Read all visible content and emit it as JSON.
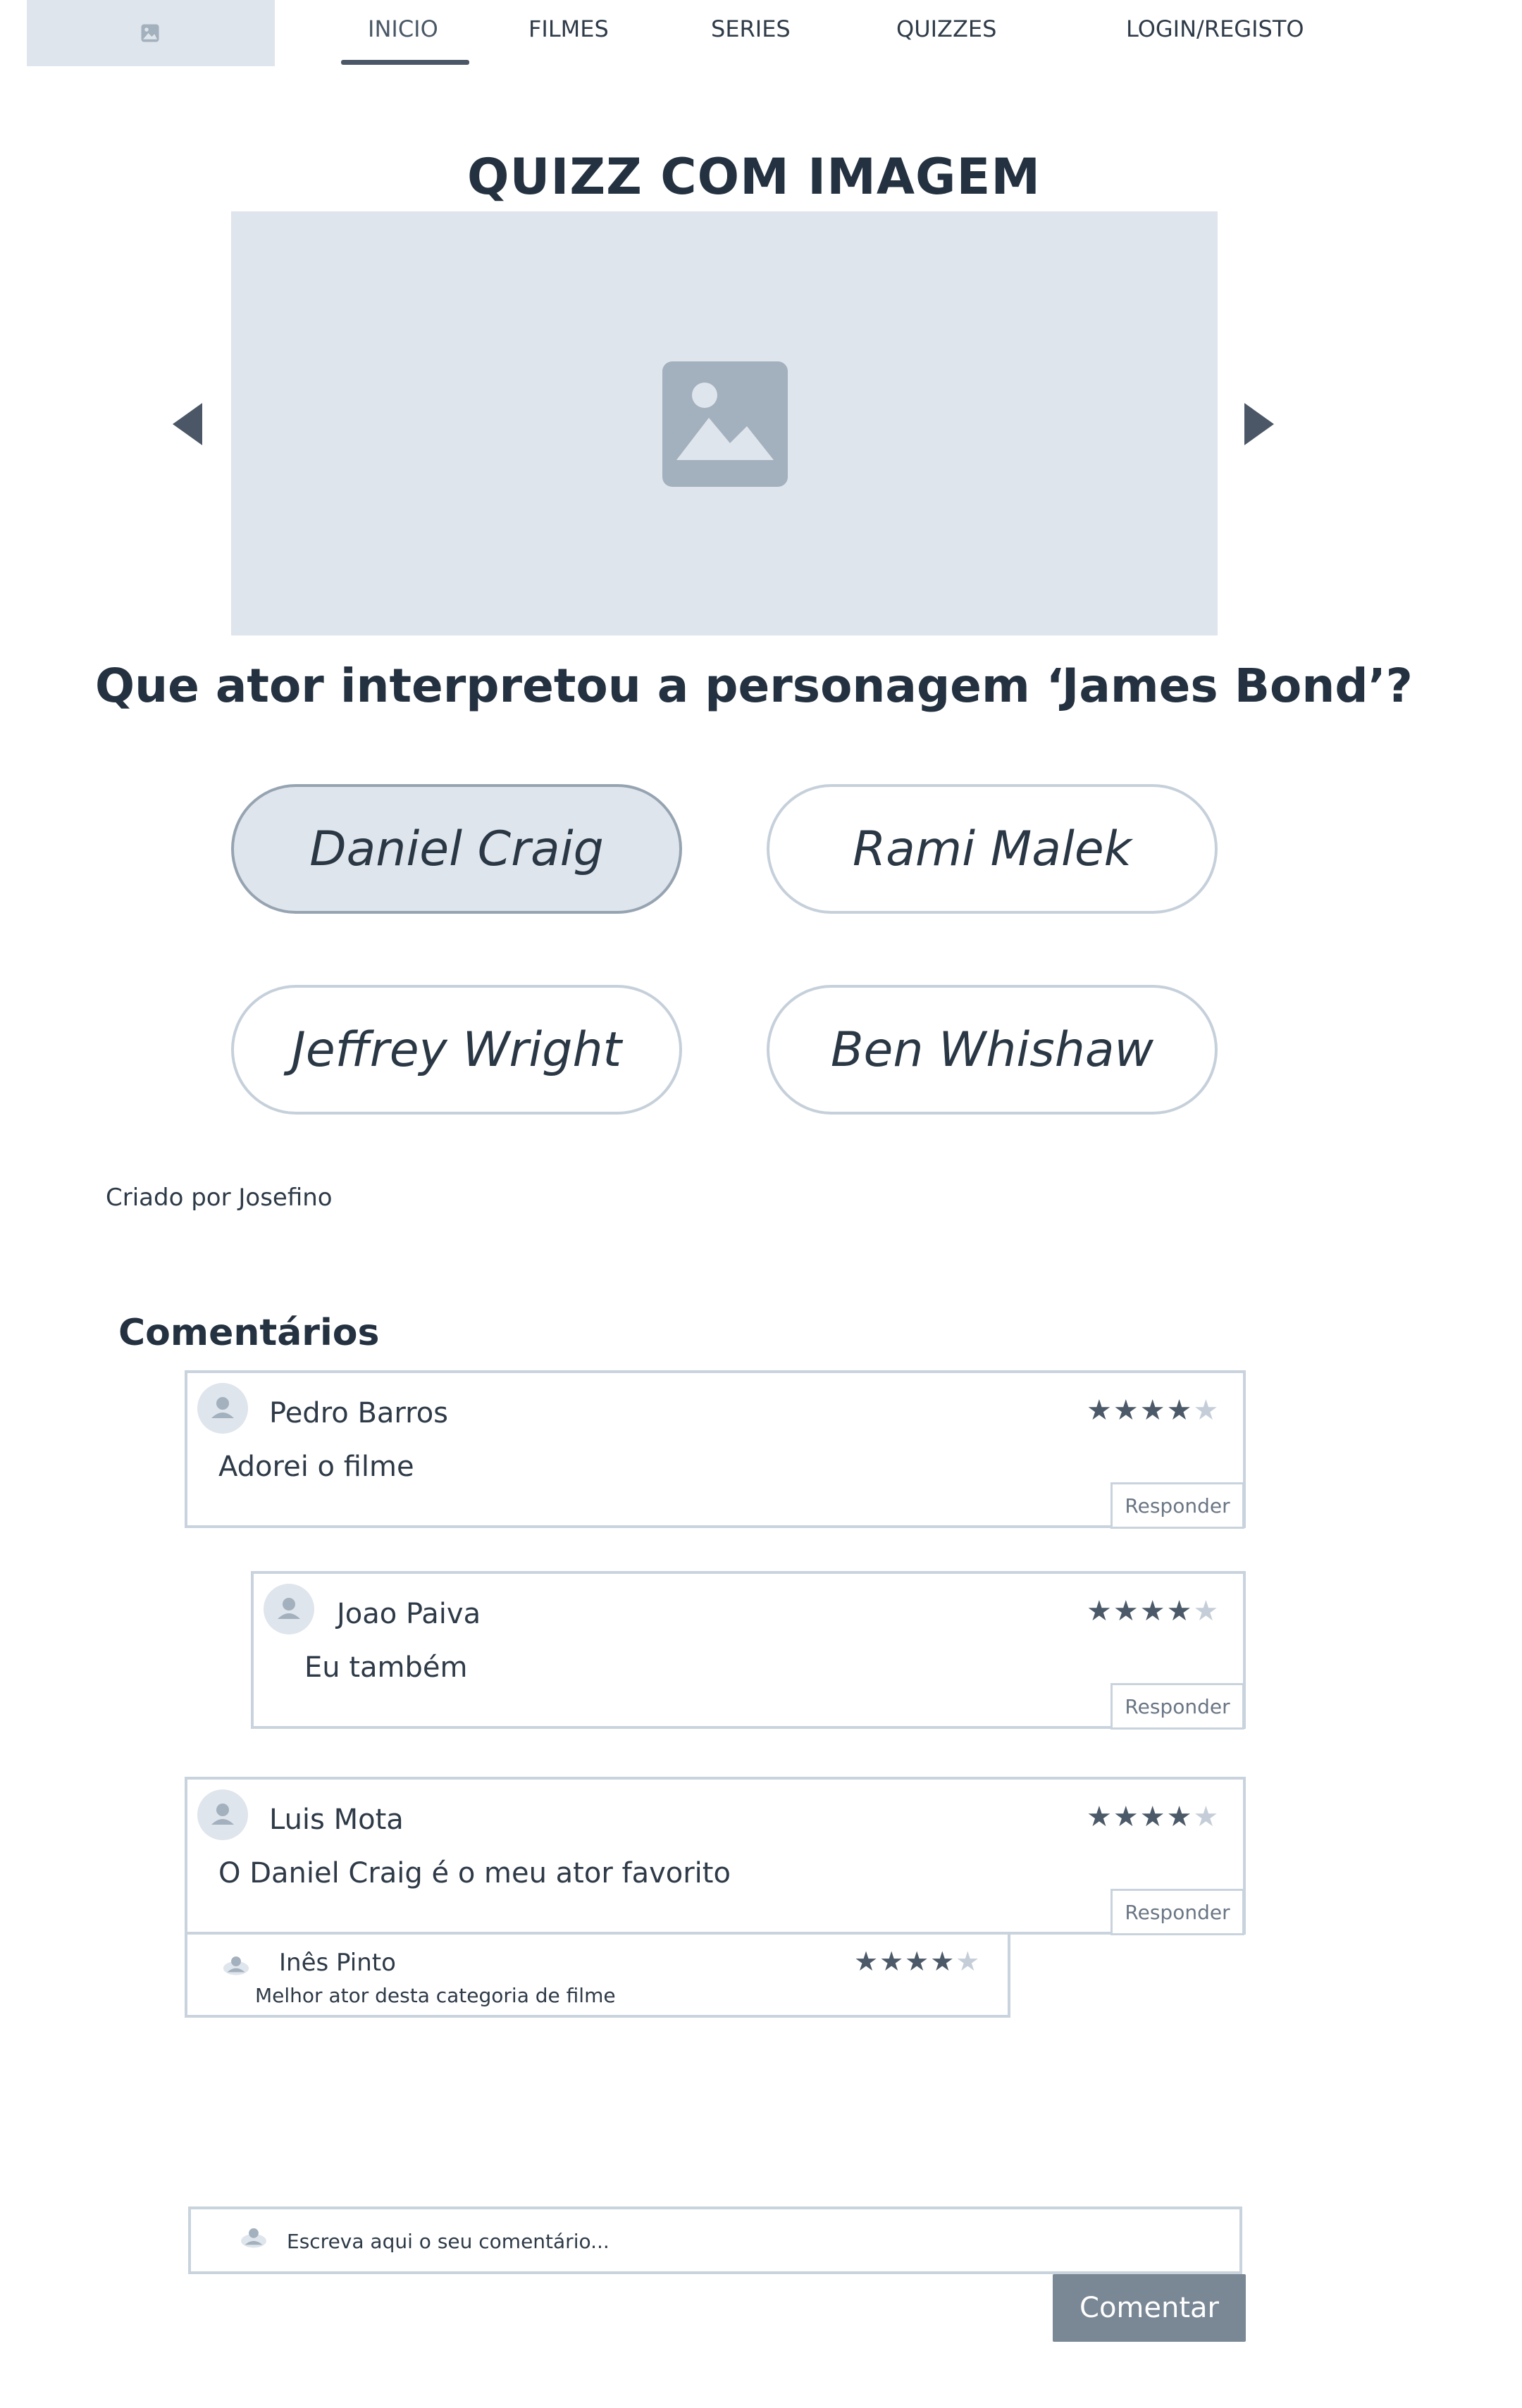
{
  "nav": {
    "items": [
      {
        "label": "INICIO"
      },
      {
        "label": "FILMES"
      },
      {
        "label": "SERIES"
      },
      {
        "label": "QUIZZES"
      },
      {
        "label": "LOGIN/REGISTO"
      }
    ]
  },
  "quiz": {
    "title": "QUIZZ COM IMAGEM",
    "question": "Que ator interpretou a personagem ‘James Bond’?",
    "answers": [
      {
        "label": "Daniel Craig"
      },
      {
        "label": "Rami Malek"
      },
      {
        "label": "Jeffrey Wright"
      },
      {
        "label": "Ben Whishaw"
      }
    ],
    "author": "Criado por Josefino"
  },
  "comments": {
    "heading": "Comentários",
    "items": [
      {
        "name": "Pedro Barros",
        "text": "Adorei o filme",
        "rating": 4,
        "reply_label": "Responder"
      },
      {
        "name": "Joao Paiva",
        "text": "Eu também",
        "rating": 4,
        "reply_label": "Responder"
      },
      {
        "name": "Luis Mota",
        "text": "O Daniel Craig é o meu ator favorito",
        "rating": 4,
        "reply_label": "Responder"
      },
      {
        "name": "Inês Pinto",
        "text": "Melhor ator desta categoria de filme",
        "rating": 4
      }
    ],
    "input_placeholder": "Escreva aqui o seu comentário...",
    "submit_label": "Comentar"
  },
  "colors": {
    "placeholder_bg": "#dfe5ec",
    "text_dark": "#243140",
    "accent": "#7a8896"
  }
}
